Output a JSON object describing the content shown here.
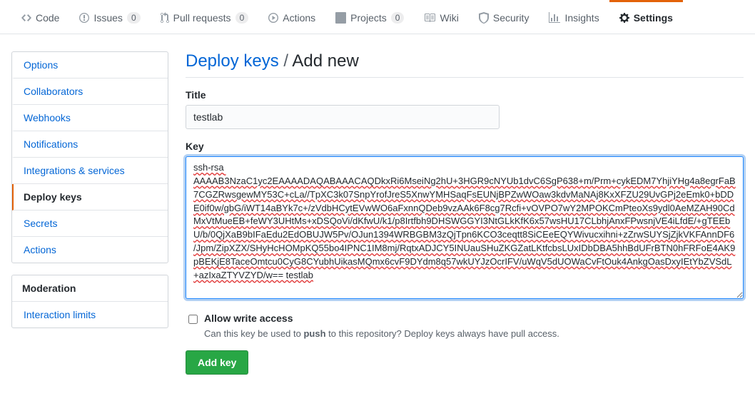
{
  "repoNav": {
    "code": "Code",
    "issues": {
      "label": "Issues",
      "count": "0"
    },
    "pulls": {
      "label": "Pull requests",
      "count": "0"
    },
    "actions": "Actions",
    "projects": {
      "label": "Projects",
      "count": "0"
    },
    "wiki": "Wiki",
    "security": "Security",
    "insights": "Insights",
    "settings": "Settings"
  },
  "sidebar": {
    "items": [
      {
        "label": "Options"
      },
      {
        "label": "Collaborators"
      },
      {
        "label": "Webhooks"
      },
      {
        "label": "Notifications"
      },
      {
        "label": "Integrations & services"
      },
      {
        "label": "Deploy keys"
      },
      {
        "label": "Secrets"
      },
      {
        "label": "Actions"
      }
    ],
    "moderation": {
      "header": "Moderation",
      "items": [
        {
          "label": "Interaction limits"
        }
      ]
    }
  },
  "subhead": {
    "crumb": "Deploy keys",
    "sep": "/",
    "page": "Add new"
  },
  "form": {
    "titleLabel": "Title",
    "titleValue": "testlab",
    "keyLabel": "Key",
    "keyValue": "ssh-rsa AAAAB3NzaC1yc2EAAAADAQABAAACAQDkxRi6MseiNg2hU+3HGR9cNYUb1dvC6SgP638+m/Prm+cykEDM7YhjiYHg4a8egrFaB7CGZRwsgewMY53C+cLa//TpXC3k07SnpYrofJreS5XnwYMHSaqFsEUNjBPZwWOaw3kdvMaNAj8KxXFZU29UvGPj2eEmk0+bDDE0if0w/gbG/iWT14aBYk7c+/zVdbHCytEVwWO6aFxnnQDeb9vzAAk6F8cg7Rcfi+vOVPO7wY2MPOKCmPteoXs9ydl0AeMZAH90CdMxVtMueEB+feWY3UHtMs+xDSQoVi/dKfwU/k1/p8Irtfbh9DHSWGGYI3NtGLkKfK6x57wsHU17CLbhjAnxFPwsnjVE4iLfdE/+gTEEbU/b/0QjXaB9bIFaEdu2EdOBUJW5Pv/OJun1394WRBGBM3zQjTpn6KCO3ceqtt8SiCEeEQYWivucxihni+zZrwSUYSjZjkVKFAnnDF6/Jpm/ZipXZX/SHyHcHOMpKQ55bo4IPNC1IM8mj/RqtxADJCY5INUauSHuZKGZatLKtfcbsLUxIDbDBA5hhBdUFrBTN0hFRFoE4AK9pBEKjE8TaceOmtcu0CyG8CYubhUikasMQmx6cvF9DYdm8q57wkUYJzOcrIFV/uWqV5dUOWaCvFtOuk4AnkgOasDxyIEtYbZVSdL+azIxaZTYVZYD/w== testlab",
    "allowWriteLabel": "Allow write access",
    "allowWriteDesc_a": "Can this key be used to ",
    "allowWriteDesc_strong": "push",
    "allowWriteDesc_b": " to this repository? Deploy keys always have pull access.",
    "submitLabel": "Add key"
  }
}
